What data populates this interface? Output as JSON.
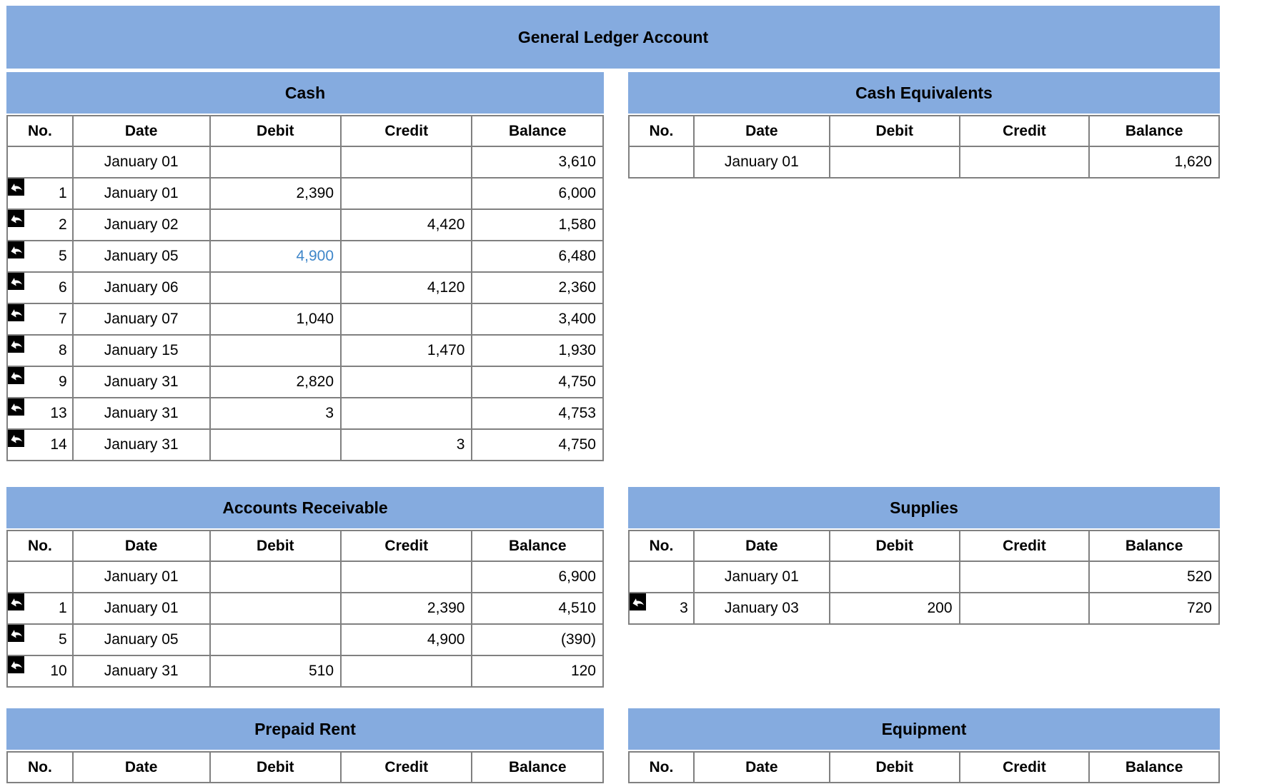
{
  "banner": {
    "title": "General Ledger Account"
  },
  "colors": {
    "header_blue": "#85ABDF",
    "border_gray": "#808080",
    "link_blue": "#3E86C9"
  },
  "icons": {
    "row_marker": "undo-arrow-icon"
  },
  "columns": [
    "No.",
    "Date",
    "Debit",
    "Credit",
    "Balance"
  ],
  "tables": {
    "cash": {
      "title": "Cash",
      "rows": [
        {
          "no": "",
          "date": "January 01",
          "debit": "",
          "credit": "",
          "balance": "3,610",
          "icon": false,
          "debit_is_link": false
        },
        {
          "no": "1",
          "date": "January 01",
          "debit": "2,390",
          "credit": "",
          "balance": "6,000",
          "icon": true,
          "debit_is_link": false
        },
        {
          "no": "2",
          "date": "January 02",
          "debit": "",
          "credit": "4,420",
          "balance": "1,580",
          "icon": true,
          "debit_is_link": false
        },
        {
          "no": "5",
          "date": "January 05",
          "debit": "4,900",
          "credit": "",
          "balance": "6,480",
          "icon": true,
          "debit_is_link": true
        },
        {
          "no": "6",
          "date": "January 06",
          "debit": "",
          "credit": "4,120",
          "balance": "2,360",
          "icon": true,
          "debit_is_link": false
        },
        {
          "no": "7",
          "date": "January 07",
          "debit": "1,040",
          "credit": "",
          "balance": "3,400",
          "icon": true,
          "debit_is_link": false
        },
        {
          "no": "8",
          "date": "January 15",
          "debit": "",
          "credit": "1,470",
          "balance": "1,930",
          "icon": true,
          "debit_is_link": false
        },
        {
          "no": "9",
          "date": "January 31",
          "debit": "2,820",
          "credit": "",
          "balance": "4,750",
          "icon": true,
          "debit_is_link": false
        },
        {
          "no": "13",
          "date": "January 31",
          "debit": "3",
          "credit": "",
          "balance": "4,753",
          "icon": true,
          "debit_is_link": false
        },
        {
          "no": "14",
          "date": "January 31",
          "debit": "",
          "credit": "3",
          "balance": "4,750",
          "icon": true,
          "debit_is_link": false
        }
      ]
    },
    "cash_equivalents": {
      "title": "Cash Equivalents",
      "rows": [
        {
          "no": "",
          "date": "January 01",
          "debit": "",
          "credit": "",
          "balance": "1,620",
          "icon": false,
          "debit_is_link": false
        }
      ]
    },
    "accounts_receivable": {
      "title": "Accounts Receivable",
      "rows": [
        {
          "no": "",
          "date": "January 01",
          "debit": "",
          "credit": "",
          "balance": "6,900",
          "icon": false,
          "debit_is_link": false
        },
        {
          "no": "1",
          "date": "January 01",
          "debit": "",
          "credit": "2,390",
          "balance": "4,510",
          "icon": true,
          "debit_is_link": false
        },
        {
          "no": "5",
          "date": "January 05",
          "debit": "",
          "credit": "4,900",
          "balance": "(390)",
          "icon": true,
          "debit_is_link": false
        },
        {
          "no": "10",
          "date": "January 31",
          "debit": "510",
          "credit": "",
          "balance": "120",
          "icon": true,
          "debit_is_link": false
        }
      ]
    },
    "supplies": {
      "title": "Supplies",
      "rows": [
        {
          "no": "",
          "date": "January 01",
          "debit": "",
          "credit": "",
          "balance": "520",
          "icon": false,
          "debit_is_link": false
        },
        {
          "no": "3",
          "date": "January 03",
          "debit": "200",
          "credit": "",
          "balance": "720",
          "icon": true,
          "debit_is_link": false
        }
      ]
    },
    "prepaid_rent": {
      "title": "Prepaid Rent",
      "rows": []
    },
    "equipment": {
      "title": "Equipment",
      "rows": []
    }
  }
}
